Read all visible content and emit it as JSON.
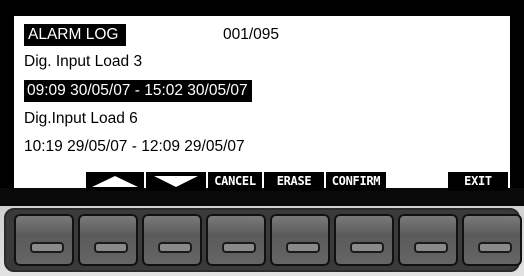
{
  "screen": {
    "title": "ALARM LOG",
    "counter": "001/095",
    "entries": [
      {
        "name": "Dig. Input Load 3",
        "period": "09:09 30/05/07 - 15:02 30/05/07"
      },
      {
        "name": "Dig.Input Load 6",
        "period": "10:19 29/05/07 - 12:09 29/05/07"
      }
    ]
  },
  "softkeys": {
    "up_icon": "arrow-up-icon",
    "down_icon": "arrow-down-icon",
    "cancel": "CANCEL",
    "erase": "ERASE",
    "confirm": "CONFIRM",
    "exit": "EXIT"
  },
  "colors": {
    "lcd_background": "#ffffff",
    "lcd_foreground": "#000000",
    "bezel": "#000000",
    "key": "#666666"
  }
}
